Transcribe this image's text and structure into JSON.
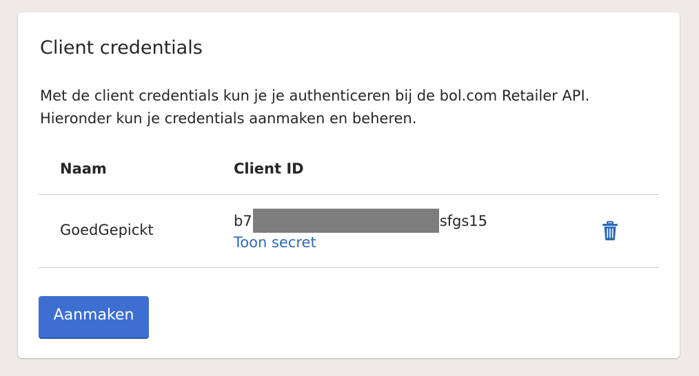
{
  "card": {
    "title": "Client credentials",
    "description_line1": "Met de client credentials kun je je authenticeren bij de bol.com Retailer API.",
    "description_line2": "Hieronder kun je credentials aanmaken en beheren."
  },
  "table": {
    "columns": [
      "Naam",
      "Client ID"
    ],
    "rows": [
      {
        "name": "GoedGepickt",
        "client_id_prefix": "b7",
        "client_id_suffix": "sfgs15",
        "show_secret_label": "Toon secret",
        "delete_icon": "trash-icon"
      }
    ]
  },
  "actions": {
    "create_label": "Aanmaken"
  },
  "colors": {
    "accent": "#3c6fd0",
    "link": "#2e6ab7",
    "background": "#efebe7"
  }
}
